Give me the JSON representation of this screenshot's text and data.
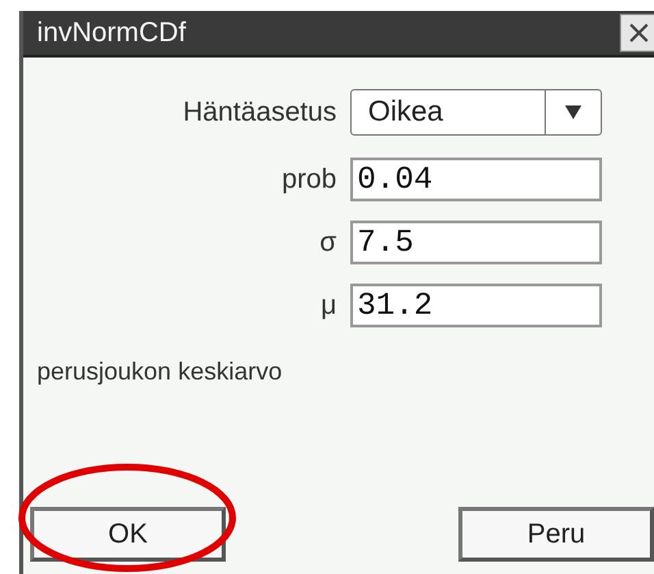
{
  "window": {
    "title": "invNormCDf"
  },
  "tail_setting": {
    "label": "Häntäasetus",
    "value": "Oikea"
  },
  "fields": [
    {
      "label": "prob",
      "value": "0.04"
    },
    {
      "label": "σ",
      "value": "7.5"
    },
    {
      "label": "μ",
      "value": "31.2"
    }
  ],
  "description": "perusjoukon keskiarvo",
  "buttons": [
    {
      "label": "OK",
      "highlighted": true
    },
    {
      "label": "Peru",
      "highlighted": false
    }
  ]
}
